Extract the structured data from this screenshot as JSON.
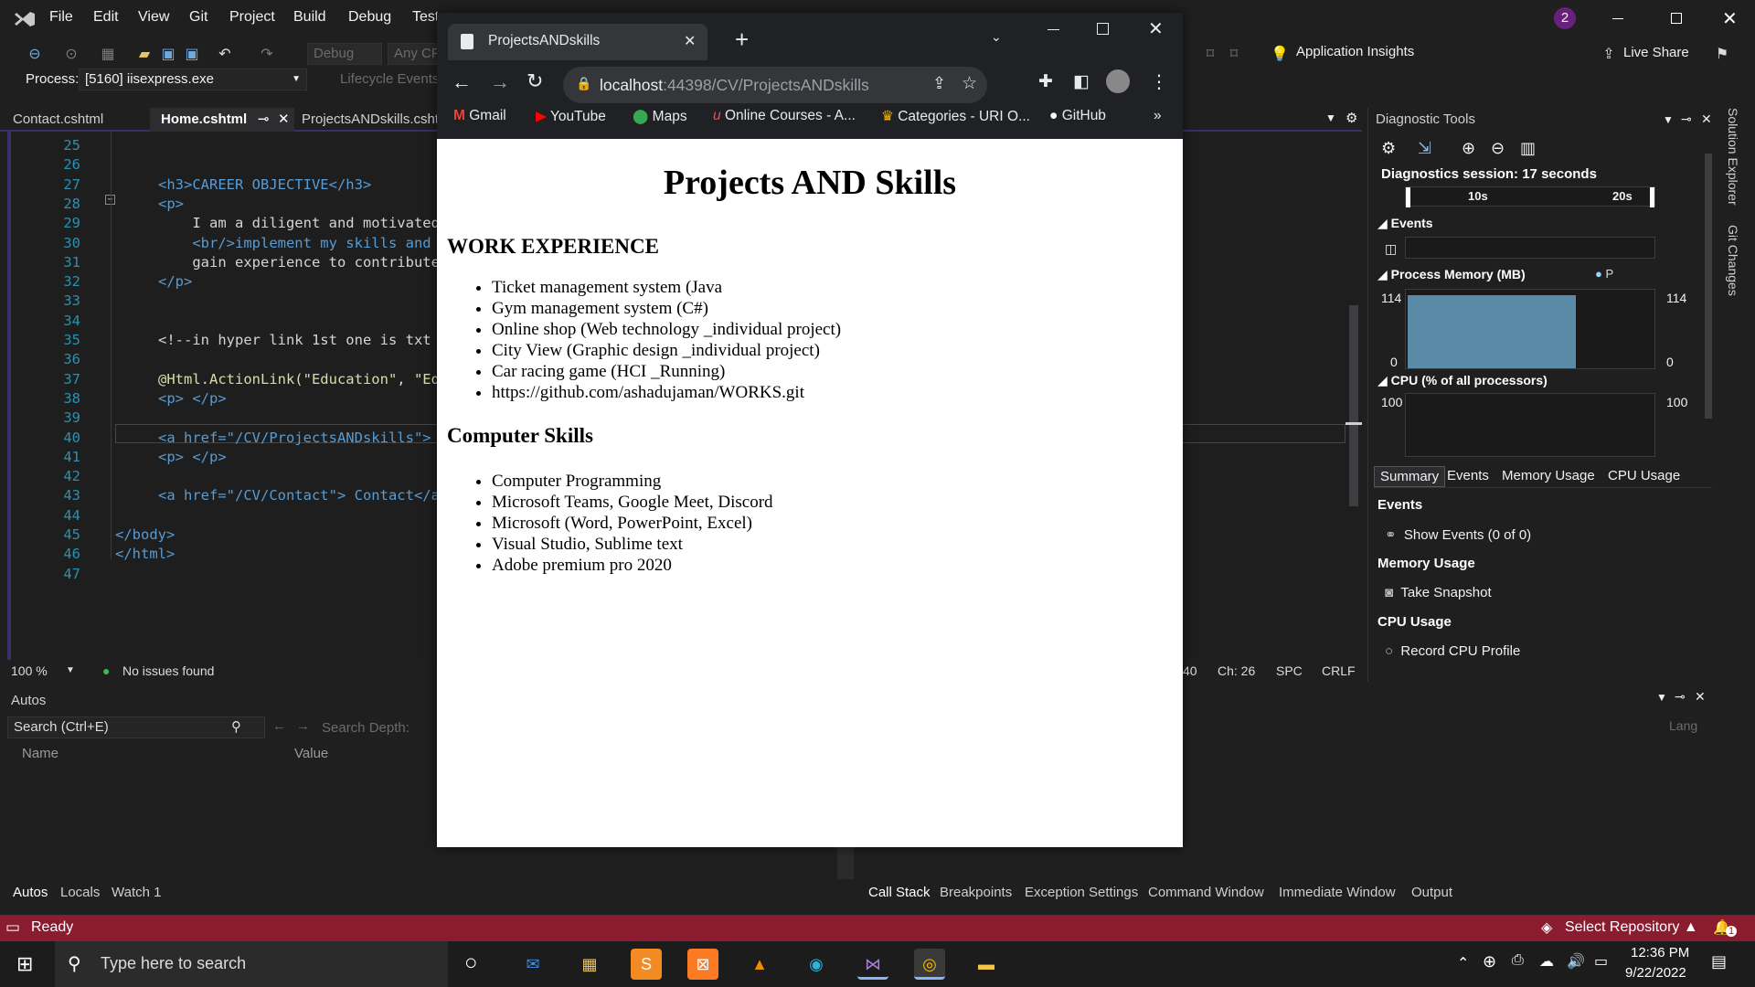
{
  "vs": {
    "menu": [
      "File",
      "Edit",
      "View",
      "Git",
      "Project",
      "Build",
      "Debug",
      "Test"
    ],
    "notification_count": "2",
    "toolbar": {
      "config": "Debug",
      "platform": "Any CP",
      "app_insights": "Application Insights",
      "live_share": "Live Share",
      "process_label": "Process:",
      "process_value": "[5160] iisexpress.exe",
      "lifecycle": "Lifecycle Events"
    },
    "tabs": [
      "Contact.cshtml",
      "Home.cshtml",
      "ProjectsANDskills.cshtml"
    ],
    "code_lines": [
      {
        "n": "25",
        "t": ""
      },
      {
        "n": "26",
        "t": ""
      },
      {
        "n": "27",
        "t": "<h3>CAREER OBJECTIVE</h3>"
      },
      {
        "n": "28",
        "t": "<p>"
      },
      {
        "n": "29",
        "t": "    I am a diligent and motivated"
      },
      {
        "n": "30",
        "t": "    <br/>implement my skills and"
      },
      {
        "n": "31",
        "t": "    gain experience to contribute"
      },
      {
        "n": "32",
        "t": "</p>"
      },
      {
        "n": "33",
        "t": ""
      },
      {
        "n": "34",
        "t": ""
      },
      {
        "n": "35",
        "t": "<!--in hyper link 1st one is txt"
      },
      {
        "n": "36",
        "t": ""
      },
      {
        "n": "37",
        "t": "@Html.ActionLink(\"Education\", \"Ed"
      },
      {
        "n": "38",
        "t": "<p> </p>"
      },
      {
        "n": "39",
        "t": ""
      },
      {
        "n": "40",
        "t": "<a href=\"/CV/ProjectsANDskills\">"
      },
      {
        "n": "41",
        "t": "<p> </p>"
      },
      {
        "n": "42",
        "t": ""
      },
      {
        "n": "43",
        "t": "<a href=\"/CV/Contact\"> Contact</a"
      },
      {
        "n": "44",
        "t": ""
      },
      {
        "n": "45",
        "t": "</body>"
      },
      {
        "n": "46",
        "t": "</html>"
      },
      {
        "n": "47",
        "t": ""
      }
    ],
    "editor_status": {
      "zoom": "100 %",
      "issues": "No issues found",
      "ln": "40",
      "ch": "Ch: 26",
      "spc": "SPC",
      "crlf": "CRLF"
    },
    "autos": {
      "title": "Autos",
      "search_placeholder": "Search (Ctrl+E)",
      "search_depth": "Search Depth:",
      "col_name": "Name",
      "col_value": "Value",
      "lang": "Lang"
    },
    "bottom_tabs_left": [
      "Autos",
      "Locals",
      "Watch 1"
    ],
    "bottom_tabs_right": [
      "Call Stack",
      "Breakpoints",
      "Exception Settings",
      "Command Window",
      "Immediate Window",
      "Output"
    ],
    "diagnostics": {
      "title": "Diagnostic Tools",
      "session": "Diagnostics session: 17 seconds",
      "tick_10": "10s",
      "tick_20": "20s",
      "events_label": "Events",
      "memory_label": "Process Memory (MB)",
      "memory_max": "114",
      "memory_min": "0",
      "cpu_label": "CPU (% of all processors)",
      "cpu_max": "100",
      "memory_legend_p": "P",
      "tabs": [
        "Summary",
        "Events",
        "Memory Usage",
        "CPU Usage"
      ],
      "sections": {
        "events": "Events",
        "show_events": "Show Events (0 of 0)",
        "memory": "Memory Usage",
        "snapshot": "Take Snapshot",
        "cpu": "CPU Usage",
        "record": "Record CPU Profile"
      }
    },
    "side_tabs": [
      "Solution Explorer",
      "Git Changes"
    ],
    "status": {
      "ready": "Ready",
      "repo": "Select Repository",
      "notifications": "1"
    }
  },
  "browser": {
    "tab_title": "ProjectsANDskills",
    "url_host": "localhost",
    "url_rest": ":44398/CV/ProjectsANDskills",
    "bookmarks": [
      "Gmail",
      "YouTube",
      "Maps",
      "Online Courses - A...",
      "Categories - URI O...",
      "GitHub"
    ],
    "page": {
      "title": "Projects AND Skills",
      "work_heading": "WORK EXPERIENCE",
      "work_items": [
        "Ticket management system (Java",
        "Gym management system (C#)",
        "Online shop (Web technology _individual project)",
        "City View (Graphic design _individual project)",
        "Car racing game (HCI _Running)",
        "https://github.com/ashadujaman/WORKS.git"
      ],
      "skills_heading": "Computer Skills",
      "skills_items": [
        "Computer Programming",
        "Microsoft Teams, Google Meet, Discord",
        "Microsoft (Word, PowerPoint, Excel)",
        "Visual Studio, Sublime text",
        "Adobe premium pro 2020"
      ]
    }
  },
  "taskbar": {
    "search_placeholder": "Type here to search",
    "time": "12:36 PM",
    "date": "9/22/2022"
  }
}
